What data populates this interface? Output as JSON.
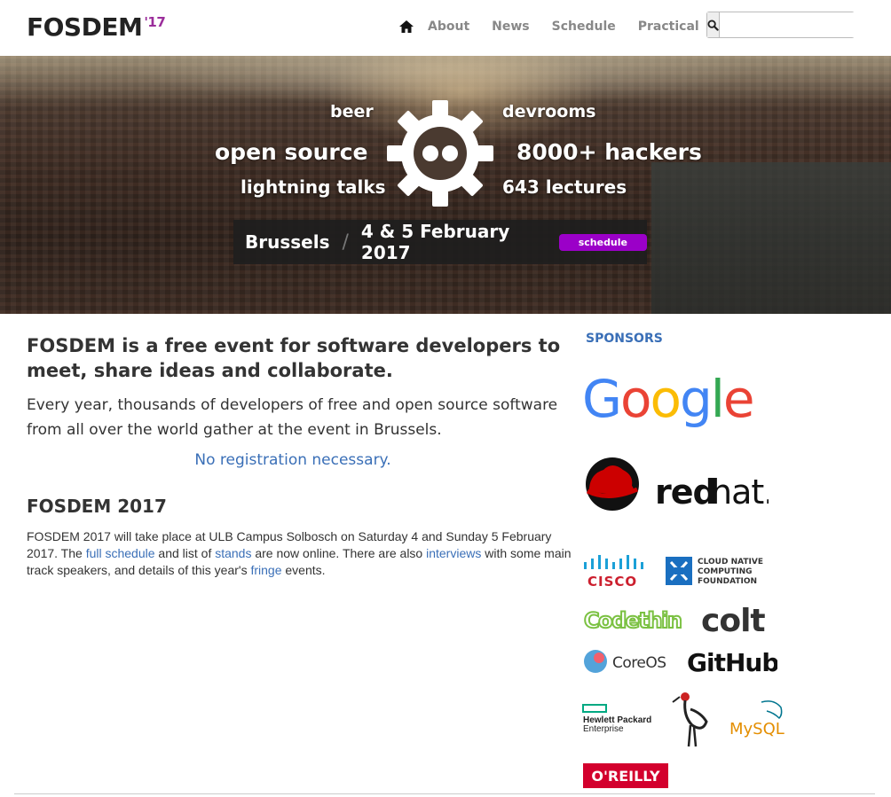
{
  "header": {
    "logo_text": "FOSDEM",
    "logo_year": "'17",
    "nav": [
      "About",
      "News",
      "Schedule",
      "Practical"
    ],
    "search_placeholder": ""
  },
  "hero": {
    "words": {
      "beer": "beer",
      "devrooms": "devrooms",
      "open_source": "open source",
      "hackers": "8000+ hackers",
      "lightning": "lightning talks",
      "lectures": "643 lectures"
    },
    "city": "Brussels",
    "separator": "/",
    "date": "4 & 5 February 2017",
    "schedule_button": "schedule"
  },
  "main": {
    "lead": "FOSDEM is a free event for software developers to meet, share ideas and collaborate.",
    "sublead": "Every year, thousands of developers of free and open source software from all over the world gather at the event in Brussels.",
    "no_registration": "No registration necessary.",
    "heading": "FOSDEM 2017",
    "para": {
      "t1": "FOSDEM 2017 will take place at ULB Campus Solbosch on Saturday 4 and Sunday 5 February 2017. The ",
      "link_schedule": "full schedule",
      "t2": " and list of ",
      "link_stands": "stands",
      "t3": " are now online. There are also ",
      "link_interviews": "interviews",
      "t4": " with some main track speakers, and details of this year's ",
      "link_fringe": "fringe",
      "t5": " events."
    }
  },
  "sponsors": {
    "title": "SPONSORS",
    "google": "Google",
    "redhat": "redhat",
    "cisco": "CISCO",
    "cncf": [
      "CLOUD NATIVE",
      "COMPUTING",
      "FOUNDATION"
    ],
    "codethink": "Codethink",
    "colt": "colt",
    "coreos": "CoreOS",
    "github": "GitHub",
    "hpe": [
      "Hewlett Packard",
      "Enterprise"
    ],
    "mysql": "MySQL",
    "oreilly": "O'REILLY"
  }
}
